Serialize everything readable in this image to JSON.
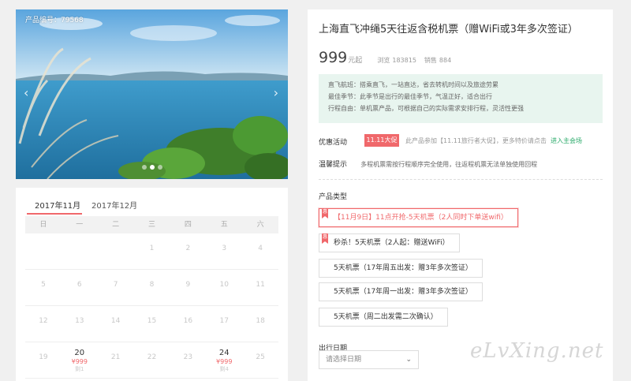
{
  "photo": {
    "product_code": "产品编号：79568",
    "arrow_left": "‹",
    "arrow_right": "›",
    "slide_count": 3,
    "active_slide": 1
  },
  "calendar": {
    "tabs": [
      "2017年11月",
      "2017年12月"
    ],
    "active_tab": 0,
    "weekdays": [
      "日",
      "一",
      "二",
      "三",
      "四",
      "五",
      "六"
    ],
    "rows": [
      [
        {
          "d": ""
        },
        {
          "d": ""
        },
        {
          "d": ""
        },
        {
          "d": "1"
        },
        {
          "d": "2"
        },
        {
          "d": "3"
        },
        {
          "d": "4"
        }
      ],
      [
        {
          "d": "5"
        },
        {
          "d": "6"
        },
        {
          "d": "7"
        },
        {
          "d": "8"
        },
        {
          "d": "9"
        },
        {
          "d": "10"
        },
        {
          "d": "11"
        }
      ],
      [
        {
          "d": "12"
        },
        {
          "d": "13"
        },
        {
          "d": "14"
        },
        {
          "d": "15"
        },
        {
          "d": "16"
        },
        {
          "d": "17"
        },
        {
          "d": "18"
        }
      ],
      [
        {
          "d": "19"
        },
        {
          "d": "20",
          "price": "¥999",
          "stock": "剩1"
        },
        {
          "d": "21"
        },
        {
          "d": "22"
        },
        {
          "d": "23"
        },
        {
          "d": "24",
          "price": "¥999",
          "stock": "剩4"
        },
        {
          "d": "25"
        }
      ]
    ]
  },
  "product": {
    "title": "上海直飞冲绳5天往返含税机票（赠WiFi或3年多次签证）",
    "price": "999",
    "price_unit": "元起",
    "views_label": "浏览",
    "views": "183815",
    "sales_label": "销售",
    "sales": "884",
    "info_lines": [
      "直飞航班：搭乘直飞，一站直达，省去转机时间以及旅途劳累",
      "最佳季节：此季节是出行的最佳季节，气温正好，适合出行",
      "行程自由：单机票产品，可根据自己的实际需求安排行程，灵活性更强"
    ],
    "promo_label": "优惠活动",
    "promo_badge": "11.11大促",
    "promo_text": "此产品参加【11.11旅行者大促】，更多特价请点击",
    "promo_link": "进入主会场",
    "tip_label": "温馨提示",
    "tip_text": "多程机票需按行程顺序完全使用，往返程机票无法单独使用回程",
    "type_label": "产品类型",
    "options": [
      "【11月9日】11点开抢-5天机票（2人同时下单送wifi）",
      "秒杀！5天机票（2人起：赠送WiFi）",
      "5天机票（17年周五出发：赠3年多次签证）",
      "5天机票（17年周一出发：赠3年多次签证）",
      "5天机票（周二出发需二次确认）"
    ],
    "flag_glyph": "惠",
    "date_label": "出行日期",
    "date_placeholder": "请选择日期"
  },
  "watermark": "eLvXing.net",
  "colors": {
    "accent": "#f0686b",
    "green": "#2aaa6a",
    "info_bg": "#e8f5ef"
  }
}
